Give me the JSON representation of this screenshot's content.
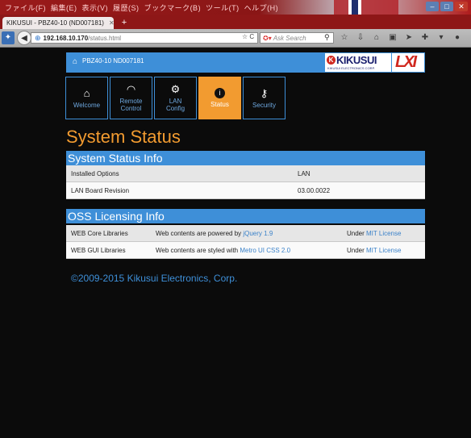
{
  "browser": {
    "menu": [
      "ファイル(F)",
      "編集(E)",
      "表示(V)",
      "履歴(S)",
      "ブックマーク(B)",
      "ツール(T)",
      "ヘルプ(H)"
    ],
    "tab_title": "KIKUSUI - PBZ40-10 (ND007181)",
    "url_host": "192.168.10.170",
    "url_path": "/status.html",
    "search_placeholder": "Ask Search"
  },
  "header": {
    "title": "PBZ40-10 ND007181",
    "brand": "KIKUSUI",
    "brand_sub": "KIKUSUI ELECTRONICS CORP.",
    "lxi": "LXI"
  },
  "nav": {
    "welcome": "Welcome",
    "remote_control": [
      "Remote",
      "Control"
    ],
    "lan_config": [
      "LAN",
      "Config"
    ],
    "status": "Status",
    "security": "Security"
  },
  "page_title": "System Status",
  "system_status": {
    "heading": "System Status Info",
    "rows": [
      {
        "label": "Installed Options",
        "value": "LAN"
      },
      {
        "label": "LAN Board Revision",
        "value": "03.00.0022"
      }
    ]
  },
  "oss": {
    "heading": "OSS Licensing Info",
    "rows": [
      {
        "name": "WEB Core Libraries",
        "desc": "Web contents are powered by ",
        "lib": "jQuery 1.9",
        "under": "Under ",
        "license": "MIT License"
      },
      {
        "name": "WEB GUI Libraries",
        "desc": "Web contents are styled with ",
        "lib": "Metro UI CSS 2.0",
        "under": "Under ",
        "license": "MIT License"
      }
    ]
  },
  "copyright": "©2009-2015 Kikusui Electronics, Corp.",
  "colors": {
    "accent": "#3e8fd8",
    "active_tile": "#f29b30",
    "page_bg": "#0b0b0b"
  }
}
